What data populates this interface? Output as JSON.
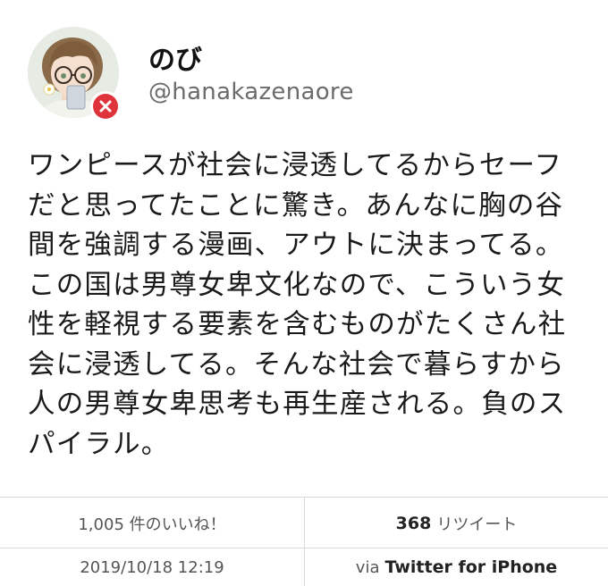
{
  "user": {
    "name": "のび",
    "handle": "@hanakazenaore"
  },
  "tweet": {
    "lines": [
      "ワンピースが社会に浸透してるからセーフ",
      "だと思ってたことに驚き。あんなに胸の谷",
      "間を強調する漫画、アウトに決まってる。",
      "この国は男尊女卑文化なので、こういう女",
      "性を軽視する要素を含むものがたくさん社",
      "会に浸透してる。そんな社会で暮らすから",
      "人の男尊女卑思考も再生産される。負のス",
      "パイラル。"
    ]
  },
  "stats": {
    "likes_label": "1,005 件のいいね！",
    "retweets_count": "368",
    "retweets_label": "リツイート"
  },
  "meta": {
    "timestamp": "2019/10/18 12:19",
    "via_prefix": "via",
    "client": "Twitter for iPhone"
  },
  "colors": {
    "badge": "#e0343c",
    "divider": "#d9d9d9"
  },
  "icons": {
    "badge": "close-icon"
  }
}
